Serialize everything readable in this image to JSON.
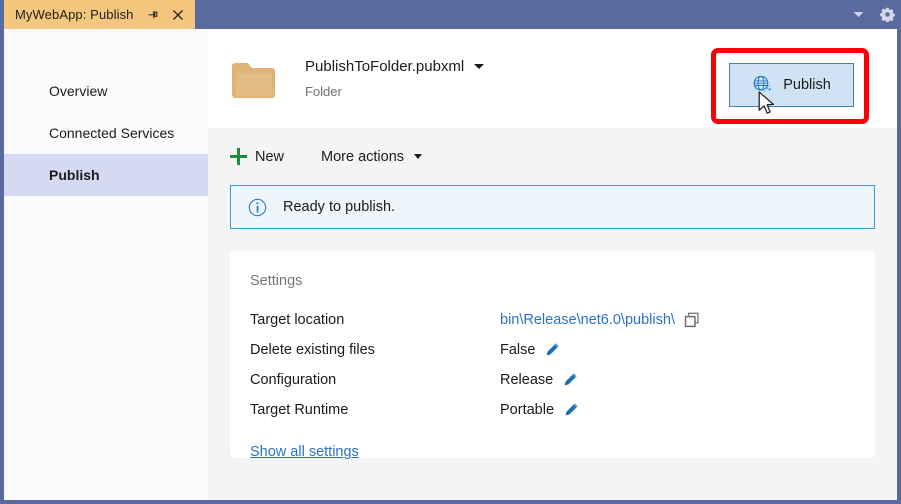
{
  "titlebar": {
    "tab_title": "MyWebApp: Publish",
    "pin_icon": "pin-icon",
    "close_icon": "close-icon",
    "chevron_icon": "chevron-down-icon",
    "gear_icon": "gear-icon",
    "tab_bg": "#f5c77e",
    "bg": "#5b6a9e"
  },
  "sidebar": {
    "items": [
      {
        "label": "Overview",
        "selected": false
      },
      {
        "label": "Connected Services",
        "selected": false
      },
      {
        "label": "Publish",
        "selected": true
      }
    ],
    "selected_bg": "#d5d9f2"
  },
  "header": {
    "folder_icon": "folder-icon",
    "profile_name": "PublishToFolder.pubxml",
    "profile_caret": "chevron-down-icon",
    "profile_subtitle": "Folder",
    "publish_button": {
      "label": "Publish",
      "icon": "publish-globe-icon",
      "bg": "#cfe3f5",
      "border": "#3f82bd"
    },
    "annotation": {
      "shape": "rectangle",
      "color": "#fb0007"
    },
    "cursor": "mouse-pointer"
  },
  "toolbar": {
    "new_label": "New",
    "new_icon": "plus-icon",
    "new_icon_color": "#1d8a3e",
    "more_actions_label": "More actions",
    "more_actions_icon": "chevron-down-icon"
  },
  "banner": {
    "icon": "info-circle-icon",
    "text": "Ready to publish.",
    "bg": "#eef6fc",
    "border": "#2f9fd6"
  },
  "settings": {
    "title": "Settings",
    "rows": [
      {
        "label": "Target location",
        "value": "bin\\Release\\net6.0\\publish\\",
        "value_type": "link",
        "action_icon": "copy-icon"
      },
      {
        "label": "Delete existing files",
        "value": "False",
        "value_type": "text",
        "action_icon": "pencil-icon"
      },
      {
        "label": "Configuration",
        "value": "Release",
        "value_type": "text",
        "action_icon": "pencil-icon"
      },
      {
        "label": "Target Runtime",
        "value": "Portable",
        "value_type": "text",
        "action_icon": "pencil-icon"
      }
    ],
    "show_all_label": "Show all settings",
    "link_color": "#2a72c8"
  }
}
